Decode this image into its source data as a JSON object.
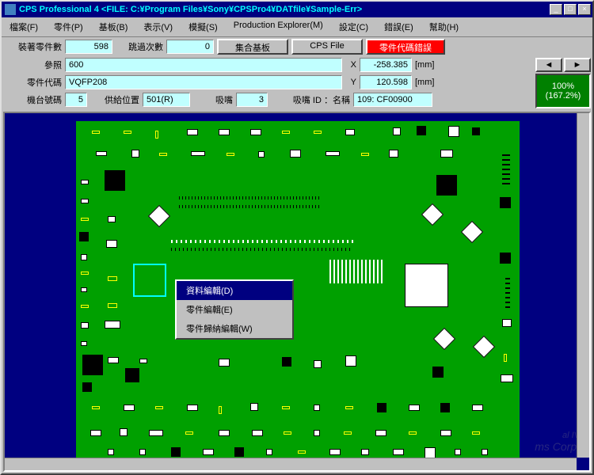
{
  "title": "CPS Professional 4  <FILE: C:¥Program Files¥Sony¥CPSPro4¥DATfile¥Sample-Err>",
  "menu": [
    "檔案(F)",
    "零件(P)",
    "基板(B)",
    "表示(V)",
    "模擬(S)",
    "Production Explorer(M)",
    "設定(C)",
    "錯誤(E)",
    "幫助(H)"
  ],
  "row1": {
    "mounted_label": "裝著零件數",
    "mounted": "598",
    "skip_label": "跳過次數",
    "skip": "0",
    "btn1": "集合基板",
    "btn2": "CPS File",
    "btn3": "零件代碼錯誤"
  },
  "row2": {
    "ref_label": "參照",
    "ref": "600",
    "x_label": "X",
    "x": "-258.385",
    "x_unit": "[mm]",
    "part_label": "零件代碼",
    "part": "VQFP208",
    "y_label": "Y",
    "y": "120.598",
    "y_unit": "[mm]",
    "machine_label": "機台號碼",
    "machine": "5",
    "feed_label": "供給位置",
    "feed": "501(R)",
    "nozzle_label": "吸嘴",
    "nozzle": "3",
    "nozid_label": "吸嘴 ID ：名稱",
    "nozid": "109: CF00900"
  },
  "zoom": {
    "pct": "100%",
    "scale": "(167.2%)"
  },
  "contextmenu": [
    "資料編輯(D)",
    "零件編輯(E)",
    "零件歸納編輯(W)"
  ],
  "watermark": {
    "line1": "al IV",
    "line2": "ms Corp."
  }
}
